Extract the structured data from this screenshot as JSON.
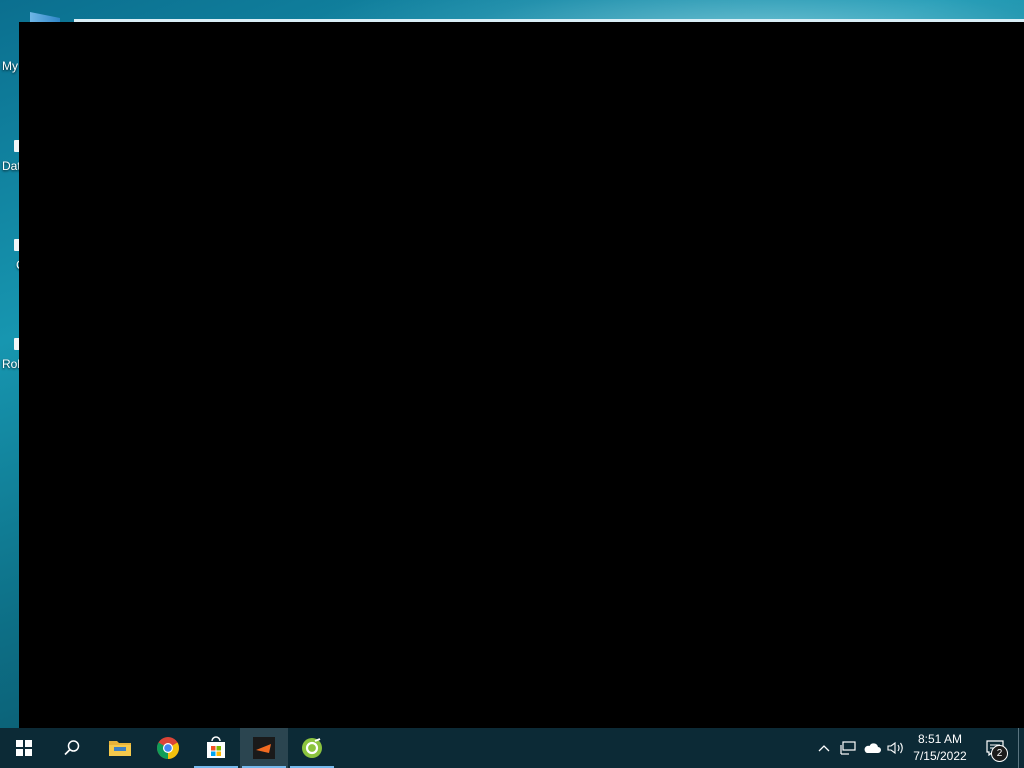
{
  "desktop": {
    "icons": [
      {
        "label": "My"
      },
      {
        "label": "Dat"
      },
      {
        "label": "C"
      },
      {
        "label": "Rob"
      }
    ]
  },
  "taskbar": {
    "apps": [
      {
        "name": "start-button",
        "icon": "windows-logo-icon"
      },
      {
        "name": "search-button",
        "icon": "search-icon"
      },
      {
        "name": "file-explorer",
        "icon": "folder-icon"
      },
      {
        "name": "google-chrome",
        "icon": "chrome-icon"
      },
      {
        "name": "microsoft-store",
        "icon": "store-icon"
      },
      {
        "name": "active-app",
        "icon": "orange-arrow-app-icon"
      },
      {
        "name": "green-app",
        "icon": "green-circle-app-icon"
      }
    ],
    "tray": {
      "clock_time": "8:51 AM",
      "clock_date": "7/15/2022",
      "notification_count": "2"
    }
  }
}
